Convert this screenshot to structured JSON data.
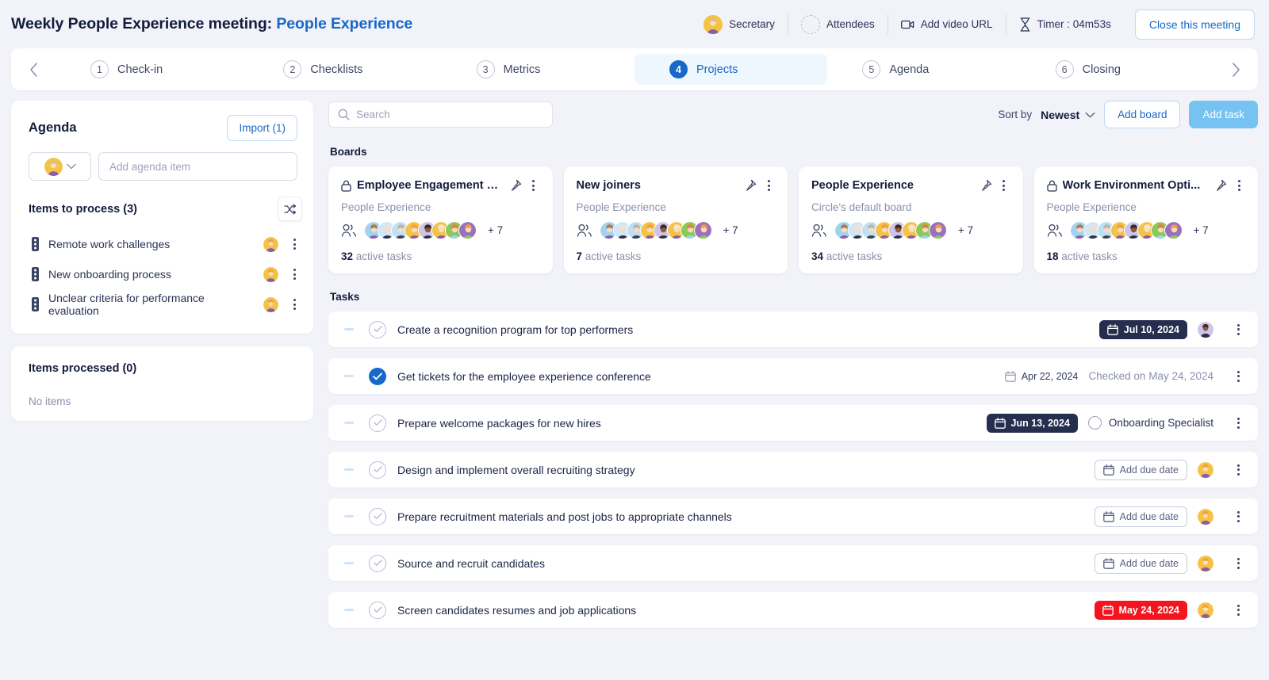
{
  "header": {
    "title_prefix": "Weekly People Experience meeting: ",
    "title_circle": "People Experience",
    "secretary_label": "Secretary",
    "attendees_label": "Attendees",
    "video_label": "Add video URL",
    "timer_label": "Timer : 04m53s",
    "close_button": "Close this meeting",
    "accent_color": "#1668c9"
  },
  "stepper": {
    "prev_icon": "chevron-left-icon",
    "next_icon": "chevron-right-icon",
    "active_index": 3,
    "steps": [
      {
        "num": "1",
        "label": "Check-in"
      },
      {
        "num": "2",
        "label": "Checklists"
      },
      {
        "num": "3",
        "label": "Metrics"
      },
      {
        "num": "4",
        "label": "Projects"
      },
      {
        "num": "5",
        "label": "Agenda"
      },
      {
        "num": "6",
        "label": "Closing"
      }
    ]
  },
  "agenda": {
    "title": "Agenda",
    "import_button": "Import (1)",
    "input_placeholder": "Add agenda item",
    "items_to_process_title": "Items to process (3)",
    "shuffle_icon": "shuffle-icon",
    "items": [
      {
        "label": "Remote work challenges"
      },
      {
        "label": "New onboarding process"
      },
      {
        "label": "Unclear criteria for performance evaluation"
      }
    ],
    "processed_title": "Items processed (0)",
    "processed_empty": "No items"
  },
  "toolbar": {
    "search_placeholder": "Search",
    "sort_by_label": "Sort by",
    "sort_value": "Newest",
    "add_board_button": "Add board",
    "add_task_button": "Add task"
  },
  "sections": {
    "boards_label": "Boards",
    "tasks_label": "Tasks"
  },
  "boards": [
    {
      "name": "Employee Engagement E...",
      "locked": true,
      "subtitle": "People Experience",
      "extra_members": "+ 7",
      "active_count": "32",
      "active_suffix": " active tasks"
    },
    {
      "name": "New joiners",
      "locked": false,
      "subtitle": "People Experience",
      "extra_members": "+ 7",
      "active_count": "7",
      "active_suffix": " active tasks"
    },
    {
      "name": "People Experience",
      "locked": false,
      "subtitle": "Circle's default board",
      "extra_members": "+ 7",
      "active_count": "34",
      "active_suffix": " active tasks"
    },
    {
      "name": "Work Environment Opti...",
      "locked": true,
      "subtitle": "People Experience",
      "extra_members": "+ 7",
      "active_count": "18",
      "active_suffix": " active tasks"
    }
  ],
  "tasks": [
    {
      "title": "Create a recognition program for top performers",
      "done": false,
      "date": "Jul 10, 2024",
      "date_style": "dark",
      "assignee_type": "avatar",
      "assignee_color": "#8e5b3a",
      "note": ""
    },
    {
      "title": "Get tickets for the employee experience conference",
      "done": true,
      "date": "Apr 22, 2024",
      "date_style": "plain",
      "assignee_type": "none",
      "note": "Checked on May 24, 2024"
    },
    {
      "title": "Prepare welcome packages for new hires",
      "done": false,
      "date": "Jun 13, 2024",
      "date_style": "dark",
      "assignee_type": "role",
      "assignee_label": "Onboarding Specialist",
      "note": ""
    },
    {
      "title": "Design and implement overall recruiting strategy",
      "done": false,
      "date": "Add due date",
      "date_style": "ghost",
      "assignee_type": "avatar",
      "assignee_color": "#f2a03d",
      "note": ""
    },
    {
      "title": "Prepare recruitment materials and post jobs to appropriate channels",
      "done": false,
      "date": "Add due date",
      "date_style": "ghost",
      "assignee_type": "avatar",
      "assignee_color": "#f2a03d",
      "note": ""
    },
    {
      "title": "Source and recruit candidates",
      "done": false,
      "date": "Add due date",
      "date_style": "ghost",
      "assignee_type": "avatar",
      "assignee_color": "#f2a03d",
      "note": ""
    },
    {
      "title": "Screen candidates resumes and job applications",
      "done": false,
      "date": "May 24, 2024",
      "date_style": "red",
      "assignee_type": "avatar",
      "assignee_color": "#f2a03d",
      "note": ""
    }
  ],
  "colors": {
    "page_bg": "#f2f2f9",
    "accent_blue": "#1668c9",
    "primary_button": "#76c2f2",
    "overdue_red": "#f4141e",
    "due_dark": "#252e4e"
  }
}
